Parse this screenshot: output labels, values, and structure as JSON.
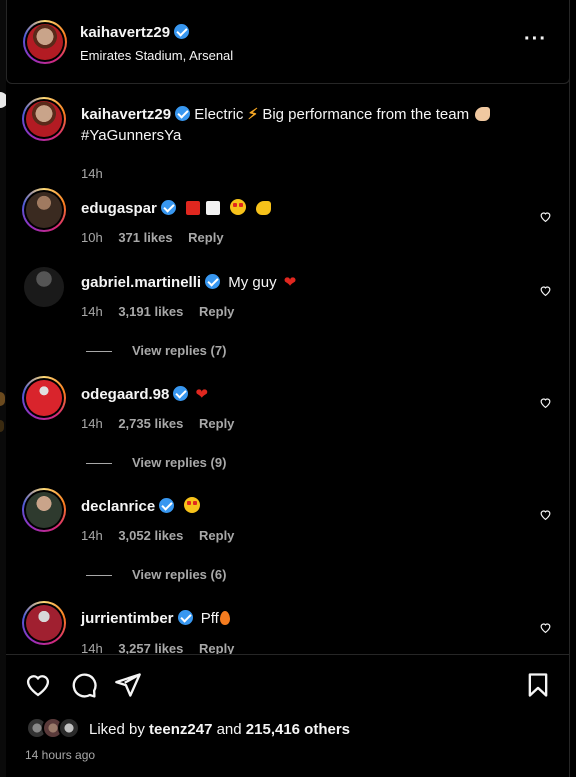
{
  "header": {
    "username": "kaihavertz29",
    "location": "Emirates Stadium, Arsenal",
    "more_icon": "more-horizontal-icon"
  },
  "caption": {
    "username": "kaihavertz29",
    "text_1": "Electric",
    "text_2": "Big performance from the team",
    "hashtag": "#YaGunnersYa",
    "time": "14h"
  },
  "comments": [
    {
      "username": "edugaspar",
      "time": "10h",
      "likes": "371 likes",
      "reply": "Reply",
      "text": "",
      "avatar_color": "#6a4b3a"
    },
    {
      "username": "gabriel.martinelli",
      "time": "14h",
      "likes": "3,191 likes",
      "reply": "Reply",
      "text": "My guy",
      "view_replies": "View replies (7)",
      "avatar_color": "#222"
    },
    {
      "username": "odegaard.98",
      "time": "14h",
      "likes": "2,735 likes",
      "reply": "Reply",
      "text": "",
      "view_replies": "View replies (9)",
      "avatar_color": "#b5121b"
    },
    {
      "username": "declanrice",
      "time": "14h",
      "likes": "3,052 likes",
      "reply": "Reply",
      "text": "",
      "view_replies": "View replies (6)",
      "avatar_color": "#394a3a"
    },
    {
      "username": "jurrientimber",
      "time": "14h",
      "likes": "3,257 likes",
      "reply": "Reply",
      "text": "Pff",
      "avatar_color": "#8a2b3a"
    }
  ],
  "actions": {
    "like_icon": "heart-icon",
    "comment_icon": "comment-icon",
    "share_icon": "send-icon",
    "save_icon": "bookmark-icon"
  },
  "likes_summary": {
    "prefix": "Liked by",
    "user": "teenz247",
    "and": "and",
    "count": "215,416 others"
  },
  "time_ago": "14 hours ago",
  "colors": {
    "background": "#000000",
    "text": "#f5f5f5",
    "secondary": "#a8a8a8",
    "verified": "#3897f0",
    "heart": "#e0271f"
  }
}
